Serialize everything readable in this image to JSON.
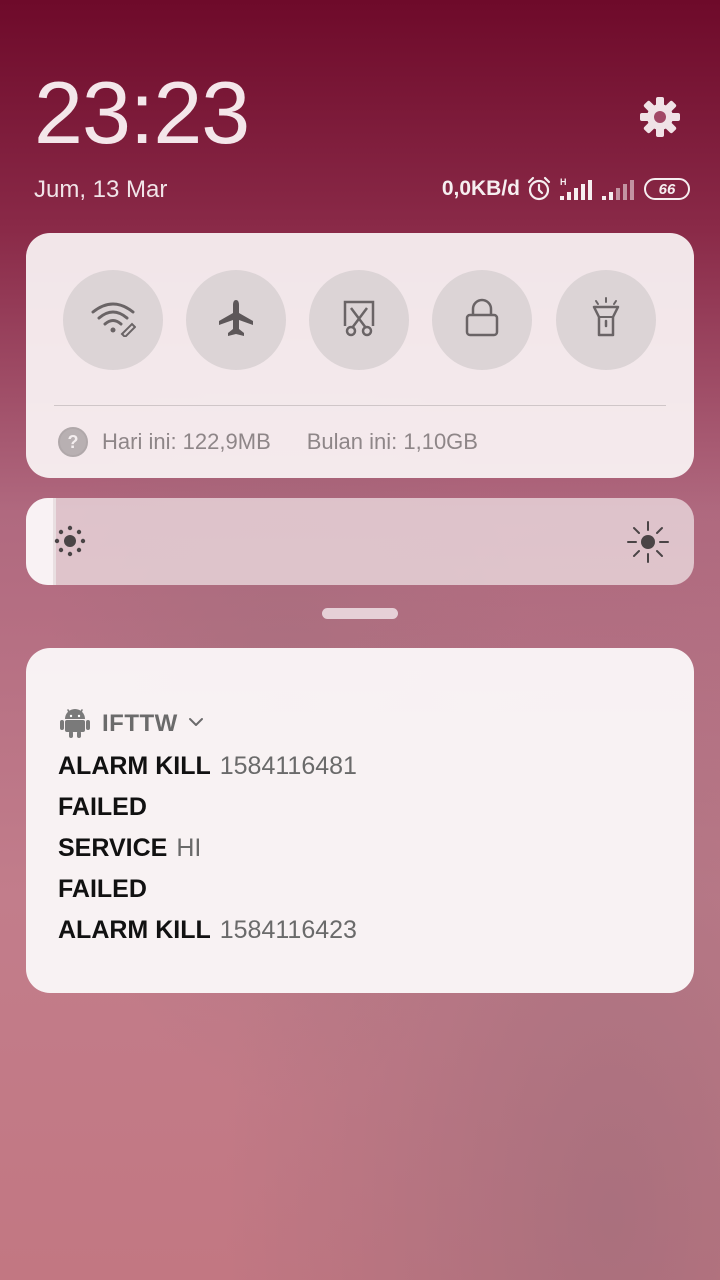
{
  "status": {
    "time": "23:23",
    "date": "Jum, 13 Mar",
    "net_speed": "0,0KB/d",
    "battery": "66"
  },
  "quick_settings": {
    "toggles": [
      {
        "name": "wifi",
        "icon": "wifi-icon"
      },
      {
        "name": "airplane",
        "icon": "airplane-icon"
      },
      {
        "name": "screenshot",
        "icon": "scissors-screenshot-icon"
      },
      {
        "name": "lock",
        "icon": "lock-icon"
      },
      {
        "name": "flashlight",
        "icon": "flashlight-icon"
      }
    ],
    "usage_today": "Hari ini: 122,9MB",
    "usage_month": "Bulan ini: 1,10GB"
  },
  "brightness": {
    "level": 0.04
  },
  "notification": {
    "app_icon": "android-icon",
    "app_name": "IFTTW",
    "lines": [
      {
        "title": "ALARM KILL",
        "text": "1584116481"
      },
      {
        "title": "FAILED",
        "text": ""
      },
      {
        "title": "SERVICE",
        "text": "HI"
      },
      {
        "title": "FAILED",
        "text": ""
      },
      {
        "title": "ALARM KILL",
        "text": "1584116423"
      }
    ]
  }
}
